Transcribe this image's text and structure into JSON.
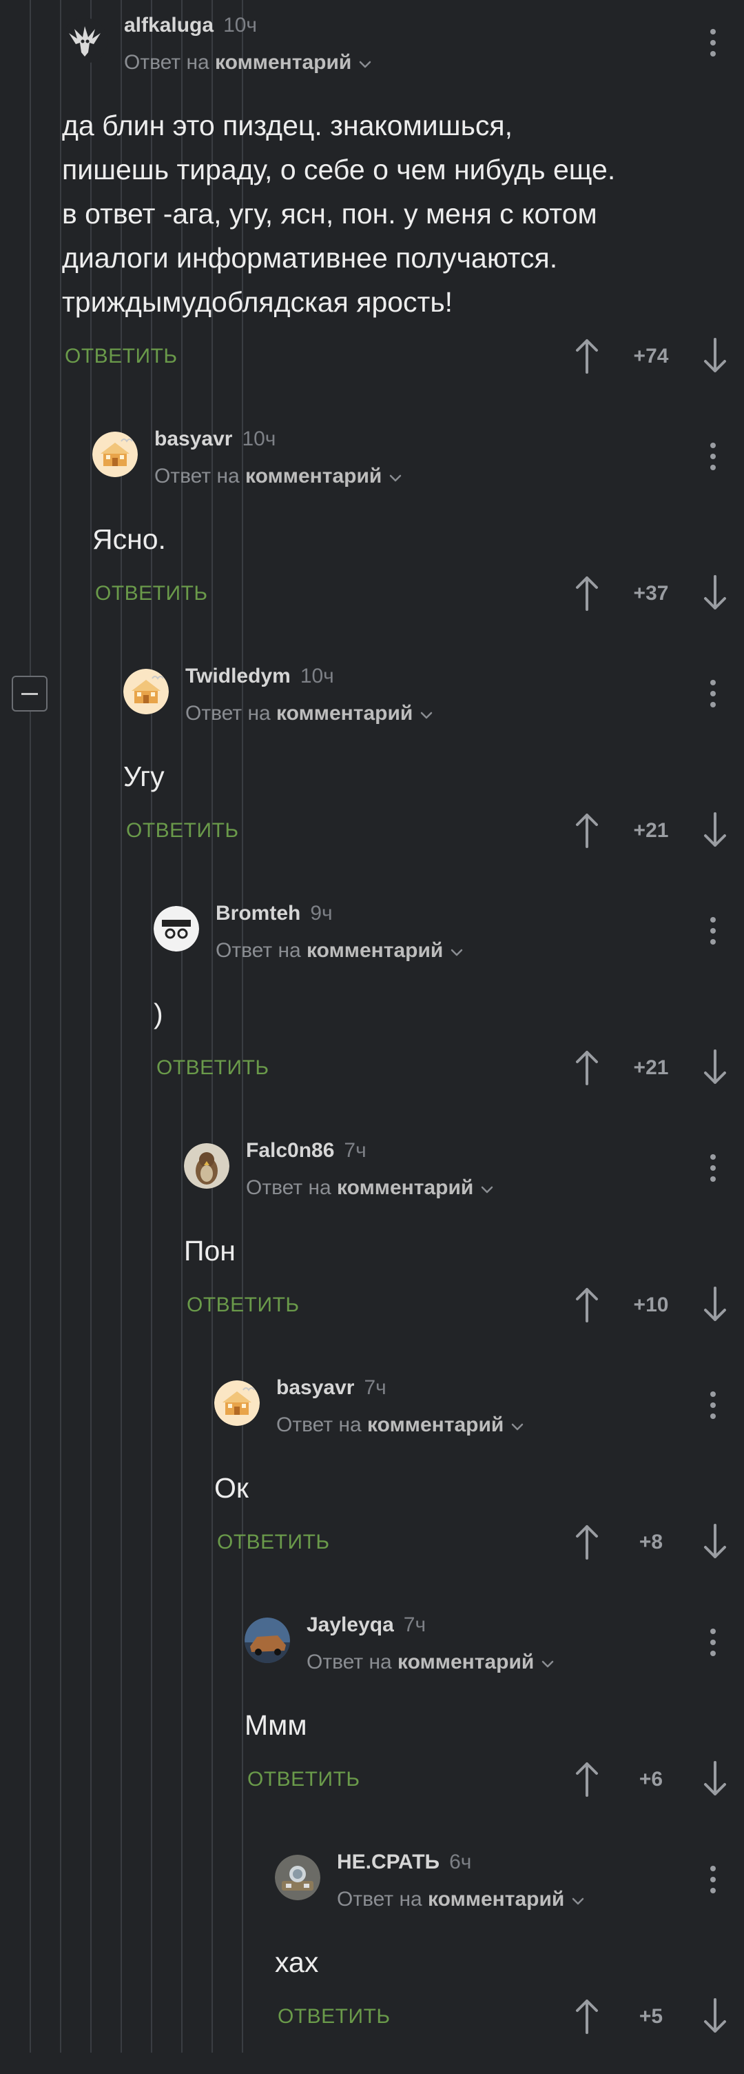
{
  "comments": [
    {
      "author": "alfkaluga",
      "time": "10ч",
      "reply_prefix": "Ответ на",
      "reply_target": "комментарий",
      "lines": [
        "да блин это пиздец. знакомишься,",
        "пишешь тираду, о себе о чем нибудь еще.",
        "в ответ -ага, угу, ясн, пон. у меня с котом",
        "диалоги информативнее получаются.",
        "триждымудоблядская ярость!"
      ],
      "reply_label": "ОТВЕТИТЬ",
      "score": "+74",
      "avatar": "bird-logo"
    },
    {
      "author": "basyavr",
      "time": "10ч",
      "reply_prefix": "Ответ на",
      "reply_target": "комментарий",
      "lines": [
        "Ясно."
      ],
      "reply_label": "ОТВЕТИТЬ",
      "score": "+37",
      "avatar": "house"
    },
    {
      "author": "Twidledym",
      "time": "10ч",
      "reply_prefix": "Ответ на",
      "reply_target": "комментарий",
      "lines": [
        "Угу"
      ],
      "reply_label": "ОТВЕТИТЬ",
      "score": "+21",
      "avatar": "house"
    },
    {
      "author": "Bromteh",
      "time": "9ч",
      "reply_prefix": "Ответ на",
      "reply_target": "комментарий",
      "lines": [
        ")"
      ],
      "reply_label": "ОТВЕТИТЬ",
      "score": "+21",
      "avatar": "face"
    },
    {
      "author": "Falc0n86",
      "time": "7ч",
      "reply_prefix": "Ответ на",
      "reply_target": "комментарий",
      "lines": [
        "Пон"
      ],
      "reply_label": "ОТВЕТИТЬ",
      "score": "+10",
      "avatar": "falcon"
    },
    {
      "author": "basyavr",
      "time": "7ч",
      "reply_prefix": "Ответ на",
      "reply_target": "комментарий",
      "lines": [
        "Ок"
      ],
      "reply_label": "ОТВЕТИТЬ",
      "score": "+8",
      "avatar": "house"
    },
    {
      "author": "Jayleyqa",
      "time": "7ч",
      "reply_prefix": "Ответ на",
      "reply_target": "комментарий",
      "lines": [
        "Ммм"
      ],
      "reply_label": "ОТВЕТИТЬ",
      "score": "+6",
      "avatar": "car"
    },
    {
      "author": "НЕ.СРАТЬ",
      "time": "6ч",
      "reply_prefix": "Ответ на",
      "reply_target": "комментарий",
      "lines": [
        "хах"
      ],
      "reply_label": "ОТВЕТИТЬ",
      "score": "+5",
      "avatar": "table"
    }
  ],
  "colors": {
    "background": "#222427",
    "reply": "#6a9a4a",
    "thread_line": "#3a3d42"
  },
  "icons": {
    "vote_up": "arrow-up-icon",
    "vote_down": "arrow-down-icon",
    "more": "more-vertical-icon",
    "collapse": "collapse-thread-icon",
    "reply_dropdown": "chevron-down-icon"
  }
}
